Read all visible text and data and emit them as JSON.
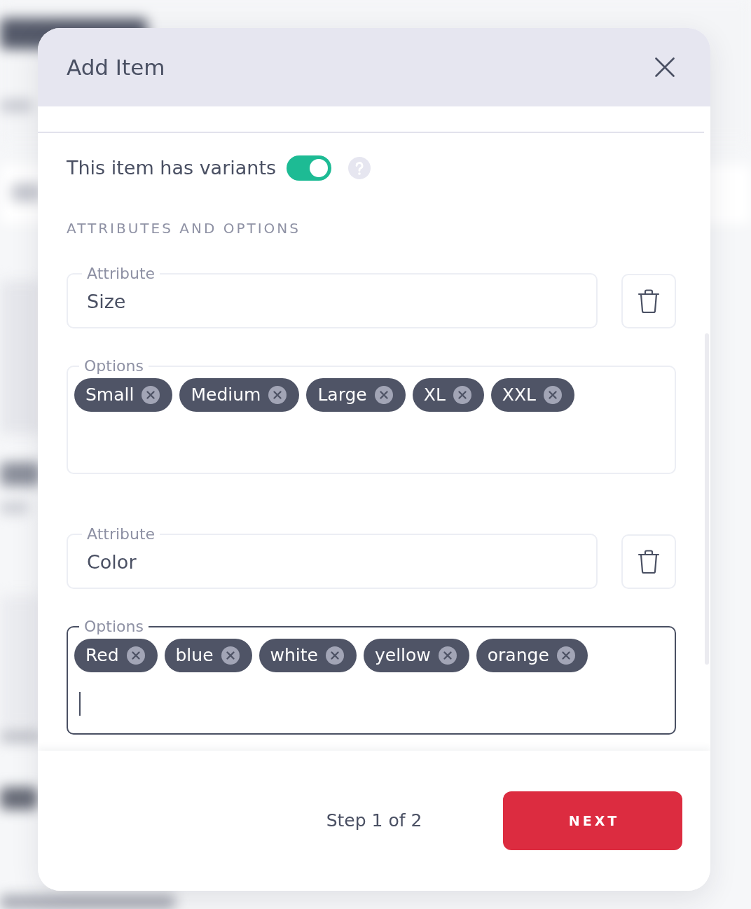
{
  "modal": {
    "title": "Add Item"
  },
  "variants": {
    "label": "This item has variants",
    "on": true
  },
  "section_heading": "ATTRIBUTES AND OPTIONS",
  "attributes": [
    {
      "label": "Attribute",
      "value": "Size",
      "options_label": "Options",
      "options": [
        "Small",
        "Medium",
        "Large",
        "XL",
        "XXL"
      ],
      "focused": false
    },
    {
      "label": "Attribute",
      "value": "Color",
      "options_label": "Options",
      "options": [
        "Red",
        "blue",
        "white",
        "yellow",
        "orange"
      ],
      "focused": true
    }
  ],
  "footer": {
    "step": "Step 1 of 2",
    "button": "NEXT"
  }
}
